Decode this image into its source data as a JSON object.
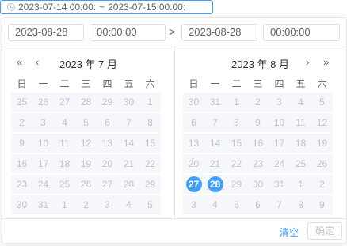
{
  "range_input": {
    "start": "2023-07-14 00:00:",
    "separator": "~",
    "end": "2023-07-15 00:00:"
  },
  "time_header": {
    "start_date": "2023-08-28",
    "start_time": "00:00:00",
    "arrow": ">",
    "end_date": "2023-08-28",
    "end_time": "00:00:00"
  },
  "left_calendar": {
    "title": "2023 年 7 月",
    "prev_year": "«",
    "prev_month": "‹",
    "weekdays": [
      "日",
      "一",
      "二",
      "三",
      "四",
      "五",
      "六"
    ],
    "rows": [
      [
        "25",
        "26",
        "27",
        "28",
        "29",
        "30",
        "1"
      ],
      [
        "2",
        "3",
        "4",
        "5",
        "6",
        "7",
        "8"
      ],
      [
        "9",
        "10",
        "11",
        "12",
        "13",
        "14",
        "15"
      ],
      [
        "16",
        "17",
        "18",
        "19",
        "20",
        "21",
        "22"
      ],
      [
        "23",
        "24",
        "25",
        "26",
        "27",
        "28",
        "29"
      ],
      [
        "30",
        "31",
        "1",
        "2",
        "3",
        "4",
        "5"
      ]
    ]
  },
  "right_calendar": {
    "title": "2023 年 8 月",
    "next_month": "›",
    "next_year": "»",
    "weekdays": [
      "日",
      "一",
      "二",
      "三",
      "四",
      "五",
      "六"
    ],
    "rows": [
      [
        "30",
        "31",
        "1",
        "2",
        "3",
        "4",
        "5"
      ],
      [
        "6",
        "7",
        "8",
        "9",
        "10",
        "11",
        "12"
      ],
      [
        "13",
        "14",
        "15",
        "16",
        "17",
        "18",
        "19"
      ],
      [
        "20",
        "21",
        "22",
        "23",
        "24",
        "25",
        "26"
      ],
      [
        "27",
        "28",
        "29",
        "30",
        "31",
        "1",
        "2"
      ],
      [
        "3",
        "4",
        "5",
        "6",
        "7",
        "8",
        "9"
      ]
    ],
    "selected": [
      "27",
      "28"
    ]
  },
  "footer": {
    "clear": "清空",
    "confirm": "确定"
  },
  "colors": {
    "accent": "#409eff",
    "disabled_text": "#c0c4cc",
    "cell_bg": "#f5f7fa"
  }
}
